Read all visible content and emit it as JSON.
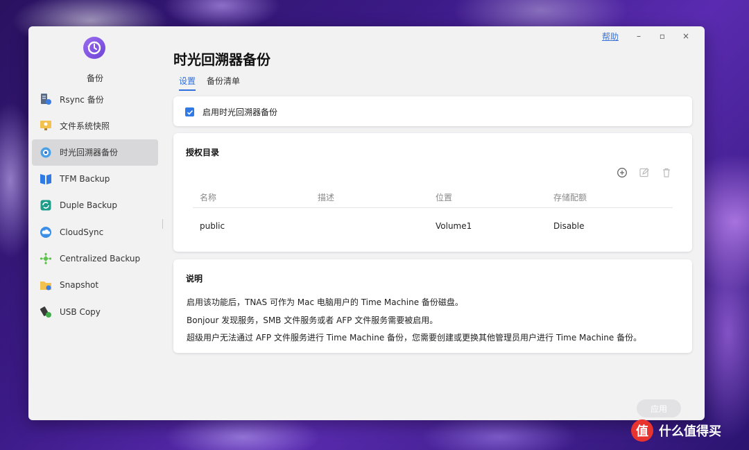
{
  "window": {
    "help_label": "帮助",
    "minimize_glyph": "–",
    "maximize_glyph": "▫",
    "close_glyph": "×"
  },
  "app": {
    "name": "备份",
    "icon": "time-machine-icon",
    "accent": "#7b52e0"
  },
  "sidebar": {
    "items": [
      {
        "label": "Rsync 备份",
        "icon": "rsync-server-icon",
        "active": false
      },
      {
        "label": "文件系统快照",
        "icon": "filesystem-snapshot-icon",
        "active": false
      },
      {
        "label": "时光回溯器备份",
        "icon": "time-machine-icon",
        "active": true
      },
      {
        "label": "TFM Backup",
        "icon": "tfm-backup-icon",
        "active": false
      },
      {
        "label": "Duple Backup",
        "icon": "duple-backup-icon",
        "active": false
      },
      {
        "label": "CloudSync",
        "icon": "cloud-sync-icon",
        "active": false
      },
      {
        "label": "Centralized Backup",
        "icon": "centralized-backup-icon",
        "active": false
      },
      {
        "label": "Snapshot",
        "icon": "snapshot-folder-icon",
        "active": false
      },
      {
        "label": "USB Copy",
        "icon": "usb-copy-icon",
        "active": false
      }
    ]
  },
  "main": {
    "title": "时光回溯器备份",
    "tabs": [
      {
        "label": "设置",
        "active": true
      },
      {
        "label": "备份清单",
        "active": false
      }
    ],
    "enable": {
      "label": "启用时光回溯器备份",
      "checked": true
    },
    "authorized_dirs": {
      "title": "授权目录",
      "toolbar": [
        "add-icon",
        "edit-icon",
        "delete-icon"
      ],
      "columns": [
        "名称",
        "描述",
        "位置",
        "存储配额"
      ],
      "rows": [
        {
          "name": "public",
          "description": "",
          "location": "Volume1",
          "quota": "Disable"
        }
      ]
    },
    "notes": {
      "title": "说明",
      "lines": [
        "启用该功能后，TNAS 可作为 Mac 电脑用户的 Time Machine 备份磁盘。",
        "Bonjour 发现服务，SMB 文件服务或者 AFP 文件服务需要被启用。",
        "超级用户无法通过 AFP 文件服务进行 Time Machine 备份，您需要创建或更换其他管理员用户进行 Time Machine 备份。"
      ]
    },
    "apply_label": "应用"
  },
  "watermark": {
    "logo_text": "值",
    "text": "什么值得买"
  },
  "colors": {
    "link": "#3a74d9",
    "tab_active": "#2f6fdb",
    "checkbox": "#2f7ae5"
  }
}
